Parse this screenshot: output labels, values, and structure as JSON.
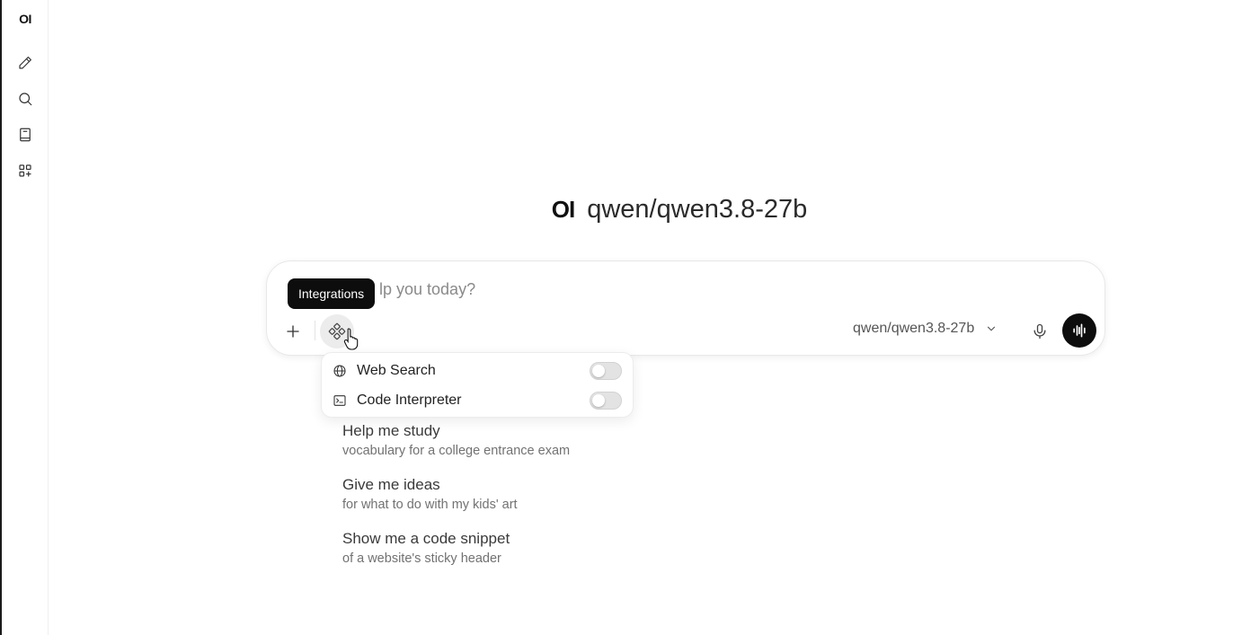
{
  "sidebar": {
    "logo": "OI",
    "items": [
      {
        "name": "new-chat",
        "icon": "pencil-icon"
      },
      {
        "name": "search",
        "icon": "search-icon"
      },
      {
        "name": "notes",
        "icon": "notebook-icon"
      },
      {
        "name": "workspace",
        "icon": "apps-plus-icon"
      }
    ]
  },
  "header": {
    "logo": "OI",
    "model_name": "qwen/qwen3.8-27b"
  },
  "composer": {
    "placeholder_visible_text": "lp you today?",
    "model_selector": "qwen/qwen3.8-27b"
  },
  "tooltip": {
    "text": "Integrations"
  },
  "integrations_menu": {
    "items": [
      {
        "label": "Web Search",
        "icon": "globe-icon",
        "enabled": false
      },
      {
        "label": "Code Interpreter",
        "icon": "terminal-icon",
        "enabled": false
      }
    ]
  },
  "suggestions": [
    {
      "title": "Help me study",
      "subtitle": "vocabulary for a college entrance exam"
    },
    {
      "title": "Give me ideas",
      "subtitle": "for what to do with my kids' art"
    },
    {
      "title": "Show me a code snippet",
      "subtitle": "of a website's sticky header"
    }
  ],
  "colors": {
    "accent_dark": "#0d0d0d",
    "background": "#ffffff",
    "toggle_off": "#e3e3e3"
  }
}
